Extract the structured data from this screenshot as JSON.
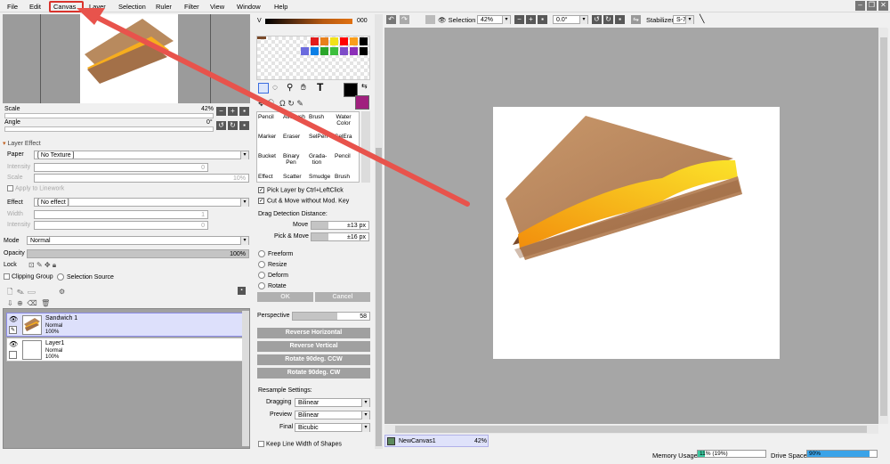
{
  "menu": [
    "File",
    "Edit",
    "Canvas",
    "Layer",
    "Selection",
    "Ruler",
    "Filter",
    "View",
    "Window",
    "Help"
  ],
  "window_buttons": [
    "minimize",
    "restore",
    "close"
  ],
  "navigator": {
    "scale_label": "Scale",
    "scale_value": "42%",
    "angle_label": "Angle",
    "angle_value": "0°"
  },
  "layer_effect": {
    "header": "Layer Effect",
    "paper_label": "Paper",
    "paper_value": "[ No Texture ]",
    "intensity_label": "Intensity",
    "intensity_value": "0",
    "scale_label": "Scale",
    "scale_value": "10%",
    "apply_linework": "Apply to Linework",
    "effect_label": "Effect",
    "effect_value": "[ No effect ]",
    "width_label": "Width",
    "width_value": "1",
    "intensity2_label": "Intensity",
    "intensity2_value": "0"
  },
  "mode": {
    "label": "Mode",
    "value": "Normal"
  },
  "opacity": {
    "label": "Opacity",
    "value": "100%",
    "fraction": 1.0
  },
  "lock_label": "Lock",
  "clipping_group": "Clipping Group",
  "selection_source": "Selection Source",
  "layers": [
    {
      "name": "Sandwich 1",
      "mode": "Normal",
      "opacity": "100%",
      "selected": true
    },
    {
      "name": "Layer1",
      "mode": "Normal",
      "opacity": "100%",
      "selected": false
    }
  ],
  "color": {
    "v_label": "V",
    "v_value": "000",
    "foreground": "#000000",
    "background": "#a0207e",
    "swatches": [
      "#e21b1b",
      "#e8801a",
      "#f2e217",
      "#ff0000",
      "#fa9e1b",
      "#000000",
      "#6b6bde",
      "#0b7fe6",
      "#2aa62a",
      "#3dbf3d",
      "#7d4cc8",
      "#8c2fb8",
      "#000000"
    ]
  },
  "tools": {
    "row1": [
      "Pencil",
      "AirBrush",
      "Brush",
      "Water Color"
    ],
    "row2": [
      "Marker",
      "Eraser",
      "SelPen",
      "SelEra"
    ],
    "row3": [
      "Bucket",
      "Binary Pen",
      "Grada-tion",
      "Pencil"
    ],
    "row4": [
      "Effect",
      "Scatter",
      "Smudge",
      "Brush"
    ]
  },
  "options": {
    "pick_layer": "Pick Layer by Ctrl+LeftClick",
    "cut_move": "Cut & Move without Mod. Key",
    "drag_detection": "Drag Detection Distance:",
    "move_label": "Move",
    "move_value": "±13 px",
    "pickmove_label": "Pick & Move",
    "pickmove_value": "±16 px",
    "freeform": "Freeform",
    "resize": "Resize",
    "deform": "Deform",
    "rotate": "Rotate",
    "ok": "OK",
    "cancel": "Cancel",
    "perspective_label": "Perspective",
    "perspective_value": "58",
    "reverse_h": "Reverse Horizontal",
    "reverse_v": "Reverse Vertical",
    "rotate_ccw": "Rotate 90deg. CCW",
    "rotate_cw": "Rotate 90deg. CW",
    "resample": "Resample Settings:",
    "dragging_label": "Dragging",
    "dragging_value": "Bilinear",
    "preview_label": "Preview",
    "preview_value": "Bilinear",
    "final_label": "Final",
    "final_value": "Bicubic",
    "keep_line": "Keep Line Width of Shapes"
  },
  "canvas_toolbar": {
    "selection_label": "Selection",
    "zoom": "42%",
    "angle": "0.0°",
    "stabilizer_label": "Stabilizer",
    "stabilizer_value": "S-7"
  },
  "canvas_tab": {
    "name": "NewCanvas1",
    "zoom": "42%"
  },
  "status": {
    "memory_label": "Memory Usage",
    "memory_value": "11% (19%)",
    "memory_fraction": 0.11,
    "drive_label": "Drive Space",
    "drive_value": "90%",
    "drive_fraction": 0.9
  },
  "colors": {
    "highlight": "#d9332c"
  }
}
